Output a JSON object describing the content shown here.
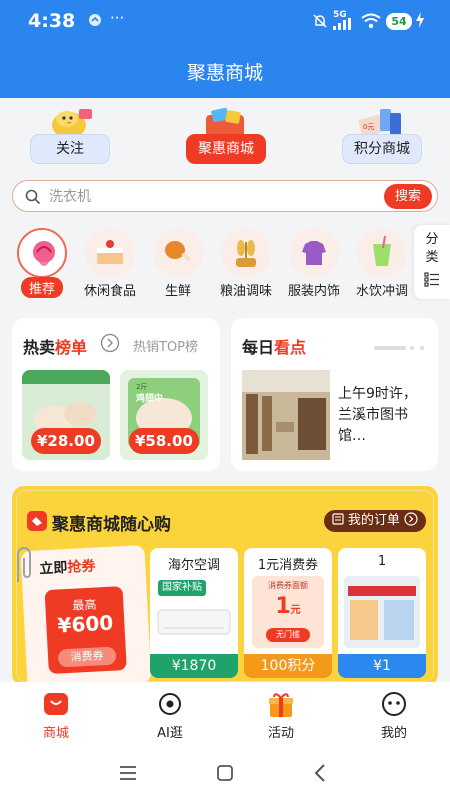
{
  "status_bar": {
    "time": "4:38",
    "network": "5G",
    "battery": "54"
  },
  "header": {
    "title": "聚惠商城"
  },
  "quick_nav": [
    {
      "label": "关注"
    },
    {
      "label": "聚惠商城"
    },
    {
      "label": "积分商城"
    }
  ],
  "search": {
    "placeholder": "洗衣机",
    "button": "搜索"
  },
  "categories": [
    {
      "label": "推荐"
    },
    {
      "label": "休闲食品"
    },
    {
      "label": "生鲜"
    },
    {
      "label": "粮油调味"
    },
    {
      "label": "服装内饰"
    },
    {
      "label": "水饮冲调"
    }
  ],
  "category_side": {
    "label_line1": "分",
    "label_line2": "类"
  },
  "hot_card": {
    "title_prefix": "热卖",
    "title_highlight": "榜单",
    "subtitle": "热销TOP榜",
    "products": [
      {
        "price": "¥28.00"
      },
      {
        "price": "¥58.00"
      }
    ],
    "pack_text_1": "2斤",
    "pack_text_2": "鸡翅中"
  },
  "daily_card": {
    "title_prefix": "每日",
    "title_highlight": "看点",
    "text": "上午9时许，兰溪市图书馆…"
  },
  "promo": {
    "title": "聚惠商城随心购",
    "orders_label": "我的订单",
    "coupon": {
      "header": "立即",
      "header_highlight": "抢券",
      "top_label": "最高",
      "amount": "¥600",
      "tag": "消费券"
    },
    "items": [
      {
        "name": "海尔空调",
        "badge": "国家补贴",
        "price": "¥1870",
        "color": "#1fa36b"
      },
      {
        "name": "1元消费券",
        "sub": "消费券面额",
        "value": "1",
        "unit": "元",
        "stamp": "无门槛",
        "price": "100积分",
        "color": "#f39a1b"
      },
      {
        "name": "1",
        "price": "¥1",
        "color": "#2b88ee"
      }
    ]
  },
  "tabs": [
    {
      "label": "商城"
    },
    {
      "label": "AI逛"
    },
    {
      "label": "活动"
    },
    {
      "label": "我的"
    }
  ],
  "colors": {
    "primary": "#2a86ee",
    "accent": "#ef3a24",
    "promo_bg": "#fbd33c"
  }
}
